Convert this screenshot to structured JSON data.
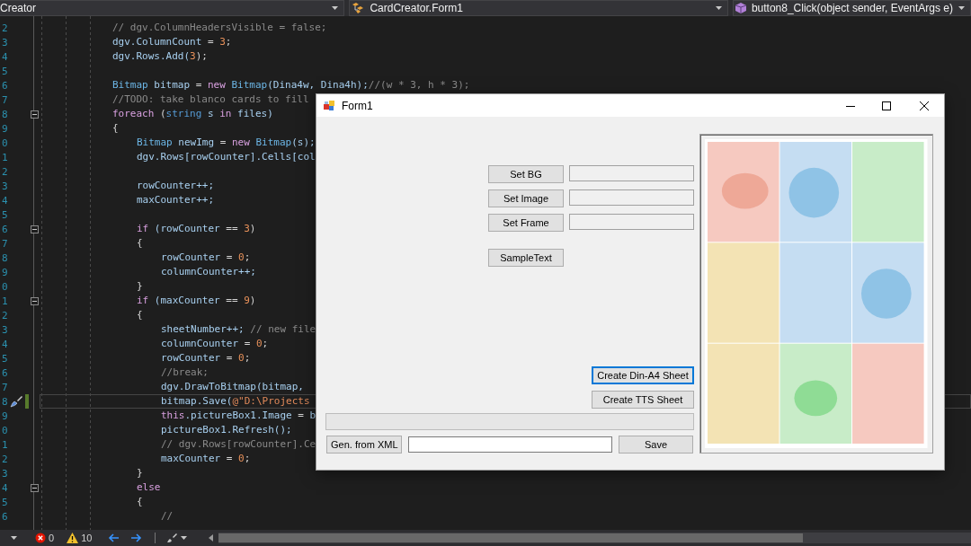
{
  "editor": {
    "navigation": [
      {
        "text": "Creator",
        "kind": "project"
      },
      {
        "text": "CardCreator.Form1",
        "kind": "class"
      },
      {
        "text": "button8_Click(object sender, EventArgs e)",
        "kind": "member"
      }
    ],
    "lines": [
      {
        "number": "2",
        "current": false,
        "modified": false,
        "collapsible": false,
        "tokens": [
          {
            "text": "// dgv.ColumnHeadersVisible = false;",
            "kind": "comment"
          }
        ]
      },
      {
        "number": "3",
        "current": false,
        "modified": false,
        "collapsible": false,
        "tokens": [
          {
            "text": "dgv.ColumnCount",
            "kind": "ident"
          },
          {
            "text": " = ",
            "kind": "punct"
          },
          {
            "text": "3",
            "kind": "number"
          },
          {
            "text": ";",
            "kind": "punct"
          }
        ]
      },
      {
        "number": "4",
        "current": false,
        "modified": false,
        "collapsible": false,
        "tokens": [
          {
            "text": "dgv.Rows.Add(",
            "kind": "ident"
          },
          {
            "text": "3",
            "kind": "number"
          },
          {
            "text": ");",
            "kind": "punct"
          }
        ]
      },
      {
        "number": "5",
        "current": false,
        "modified": false,
        "collapsible": false
      },
      {
        "number": "6",
        "current": false,
        "modified": false,
        "collapsible": false,
        "tokens": [
          {
            "text": "Bitmap",
            "kind": "type"
          },
          {
            "text": " bitmap",
            "kind": "ident"
          },
          {
            "text": " = ",
            "kind": "punct"
          },
          {
            "text": "new",
            "kind": "keyword"
          },
          {
            "text": " Bitmap",
            "kind": "type"
          },
          {
            "text": "(Dina4w, Dina4h);",
            "kind": "ident"
          },
          {
            "text": "//(w * 3, h * 3);",
            "kind": "comment"
          }
        ]
      },
      {
        "number": "7",
        "current": false,
        "modified": false,
        "collapsible": false,
        "tokens": [
          {
            "text": "//TODO: take blanco cards to fill",
            "kind": "comment"
          }
        ]
      },
      {
        "number": "8",
        "current": false,
        "modified": false,
        "collapsible": true,
        "tokens": [
          {
            "text": "foreach",
            "kind": "keyword"
          },
          {
            "text": " (",
            "kind": "punct"
          },
          {
            "text": "string",
            "kind": "builtin"
          },
          {
            "text": " s ",
            "kind": "ident"
          },
          {
            "text": "in",
            "kind": "keyword"
          },
          {
            "text": " files)",
            "kind": "ident"
          }
        ]
      },
      {
        "number": "9",
        "current": false,
        "modified": false,
        "collapsible": false,
        "tokens": [
          {
            "text": "{",
            "kind": "punct"
          }
        ],
        "children": [
          {
            "number": "0",
            "current": false,
            "modified": false,
            "collapsible": false,
            "tokens": [
              {
                "text": "Bitmap",
                "kind": "type"
              },
              {
                "text": " newImg",
                "kind": "ident"
              },
              {
                "text": " = ",
                "kind": "punct"
              },
              {
                "text": "new",
                "kind": "keyword"
              },
              {
                "text": " Bitmap",
                "kind": "type"
              },
              {
                "text": "(s);",
                "kind": "ident"
              }
            ]
          },
          {
            "number": "1",
            "current": false,
            "modified": false,
            "collapsible": false,
            "tokens": [
              {
                "text": "dgv.Rows[rowCounter].Cells[col",
                "kind": "ident"
              }
            ]
          },
          {
            "number": "2",
            "current": false,
            "modified": false,
            "collapsible": false
          },
          {
            "number": "3",
            "current": false,
            "modified": false,
            "collapsible": false,
            "tokens": [
              {
                "text": "rowCounter++;",
                "kind": "ident"
              }
            ]
          },
          {
            "number": "4",
            "current": false,
            "modified": false,
            "collapsible": false,
            "tokens": [
              {
                "text": "maxCounter++;",
                "kind": "ident"
              }
            ]
          },
          {
            "number": "5",
            "current": false,
            "modified": false,
            "collapsible": false
          },
          {
            "number": "6",
            "current": false,
            "modified": false,
            "collapsible": true,
            "tokens": [
              {
                "text": "if",
                "kind": "keyword"
              },
              {
                "text": " (rowCounter",
                "kind": "ident"
              },
              {
                "text": " == ",
                "kind": "punct"
              },
              {
                "text": "3",
                "kind": "number"
              },
              {
                "text": ")",
                "kind": "punct"
              }
            ]
          },
          {
            "number": "7",
            "current": false,
            "modified": false,
            "collapsible": false,
            "tokens": [
              {
                "text": "{",
                "kind": "punct"
              }
            ],
            "children": [
              {
                "number": "8",
                "current": false,
                "modified": false,
                "collapsible": false,
                "tokens": [
                  {
                    "text": "rowCounter",
                    "kind": "ident"
                  },
                  {
                    "text": " = ",
                    "kind": "punct"
                  },
                  {
                    "text": "0",
                    "kind": "number"
                  },
                  {
                    "text": ";",
                    "kind": "punct"
                  }
                ]
              },
              {
                "number": "9",
                "current": false,
                "modified": false,
                "collapsible": false,
                "tokens": [
                  {
                    "text": "columnCounter++;",
                    "kind": "ident"
                  }
                ]
              }
            ]
          },
          {
            "number": "0",
            "current": false,
            "modified": false,
            "collapsible": false,
            "tokens": [
              {
                "text": "}",
                "kind": "punct"
              }
            ]
          },
          {
            "number": "1",
            "current": false,
            "modified": false,
            "collapsible": true,
            "tokens": [
              {
                "text": "if",
                "kind": "keyword"
              },
              {
                "text": " (maxCounter",
                "kind": "ident"
              },
              {
                "text": " == ",
                "kind": "punct"
              },
              {
                "text": "9",
                "kind": "number"
              },
              {
                "text": ")",
                "kind": "punct"
              }
            ]
          },
          {
            "number": "2",
            "current": false,
            "modified": false,
            "collapsible": false,
            "tokens": [
              {
                "text": "{",
                "kind": "punct"
              }
            ],
            "children": [
              {
                "number": "3",
                "current": false,
                "modified": false,
                "collapsible": false,
                "tokens": [
                  {
                    "text": "sheetNumber++;",
                    "kind": "ident"
                  },
                  {
                    "text": " // new file",
                    "kind": "comment"
                  }
                ]
              },
              {
                "number": "4",
                "current": false,
                "modified": false,
                "collapsible": false,
                "tokens": [
                  {
                    "text": "columnCounter",
                    "kind": "ident"
                  },
                  {
                    "text": " = ",
                    "kind": "punct"
                  },
                  {
                    "text": "0",
                    "kind": "number"
                  },
                  {
                    "text": ";",
                    "kind": "punct"
                  }
                ]
              },
              {
                "number": "5",
                "current": false,
                "modified": false,
                "collapsible": false,
                "tokens": [
                  {
                    "text": "rowCounter",
                    "kind": "ident"
                  },
                  {
                    "text": " = ",
                    "kind": "punct"
                  },
                  {
                    "text": "0",
                    "kind": "number"
                  },
                  {
                    "text": ";",
                    "kind": "punct"
                  }
                ]
              },
              {
                "number": "6",
                "current": false,
                "modified": false,
                "collapsible": false,
                "tokens": [
                  {
                    "text": "//break;",
                    "kind": "comment"
                  }
                ]
              },
              {
                "number": "7",
                "current": false,
                "modified": false,
                "collapsible": false,
                "tokens": [
                  {
                    "text": "dgv.DrawToBitmap(bitmap,",
                    "kind": "ident"
                  }
                ]
              },
              {
                "number": "8",
                "current": true,
                "modified": true,
                "collapsible": false,
                "tokens": [
                  {
                    "text": "bitmap.Save(",
                    "kind": "ident"
                  },
                  {
                    "text": "@\"D:\\Projects",
                    "kind": "string"
                  }
                ]
              },
              {
                "number": "9",
                "current": false,
                "modified": false,
                "collapsible": false,
                "tokens": [
                  {
                    "text": "this",
                    "kind": "keyword"
                  },
                  {
                    "text": ".pictureBox1.Image",
                    "kind": "ident"
                  },
                  {
                    "text": " = ",
                    "kind": "punct"
                  },
                  {
                    "text": "b",
                    "kind": "ident"
                  }
                ]
              },
              {
                "number": "0",
                "current": false,
                "modified": false,
                "collapsible": false,
                "tokens": [
                  {
                    "text": "pictureBox1.Refresh();",
                    "kind": "ident"
                  }
                ]
              },
              {
                "number": "1",
                "current": false,
                "modified": false,
                "collapsible": false,
                "tokens": [
                  {
                    "text": "// dgv.Rows[rowCounter].Ce",
                    "kind": "comment"
                  }
                ]
              },
              {
                "number": "2",
                "current": false,
                "modified": false,
                "collapsible": false,
                "tokens": [
                  {
                    "text": "maxCounter",
                    "kind": "ident"
                  },
                  {
                    "text": " = ",
                    "kind": "punct"
                  },
                  {
                    "text": "0",
                    "kind": "number"
                  },
                  {
                    "text": ";",
                    "kind": "punct"
                  }
                ]
              }
            ]
          },
          {
            "number": "3",
            "current": false,
            "modified": false,
            "collapsible": false,
            "tokens": [
              {
                "text": "}",
                "kind": "punct"
              }
            ]
          },
          {
            "number": "4",
            "current": false,
            "modified": false,
            "collapsible": true,
            "tokens": [
              {
                "text": "else",
                "kind": "keyword"
              }
            ]
          },
          {
            "number": "5",
            "current": false,
            "modified": false,
            "collapsible": false,
            "tokens": [
              {
                "text": "{",
                "kind": "punct"
              }
            ],
            "children": [
              {
                "number": "6",
                "current": false,
                "modified": false,
                "collapsible": false,
                "tokens": [
                  {
                    "text": "//",
                    "kind": "comment"
                  }
                ]
              }
            ]
          }
        ]
      }
    ],
    "status_bar": {
      "errors": "0",
      "warnings": "10"
    }
  },
  "form": {
    "title": "Form1",
    "asset_rows": [
      {
        "button": "Set BG",
        "field_disabled": true
      },
      {
        "button": "Set Image",
        "field_disabled": true
      },
      {
        "button": "Set Frame",
        "field_disabled": true
      }
    ],
    "sample_button": "SampleText",
    "sheet_buttons": [
      {
        "label": "Create Din-A4 Sheet",
        "focused": true
      },
      {
        "label": "Create TTS Sheet",
        "focused": false
      }
    ],
    "xml_button": "Gen. from XML",
    "path_field": {
      "disabled": false
    },
    "save_button": "Save"
  }
}
